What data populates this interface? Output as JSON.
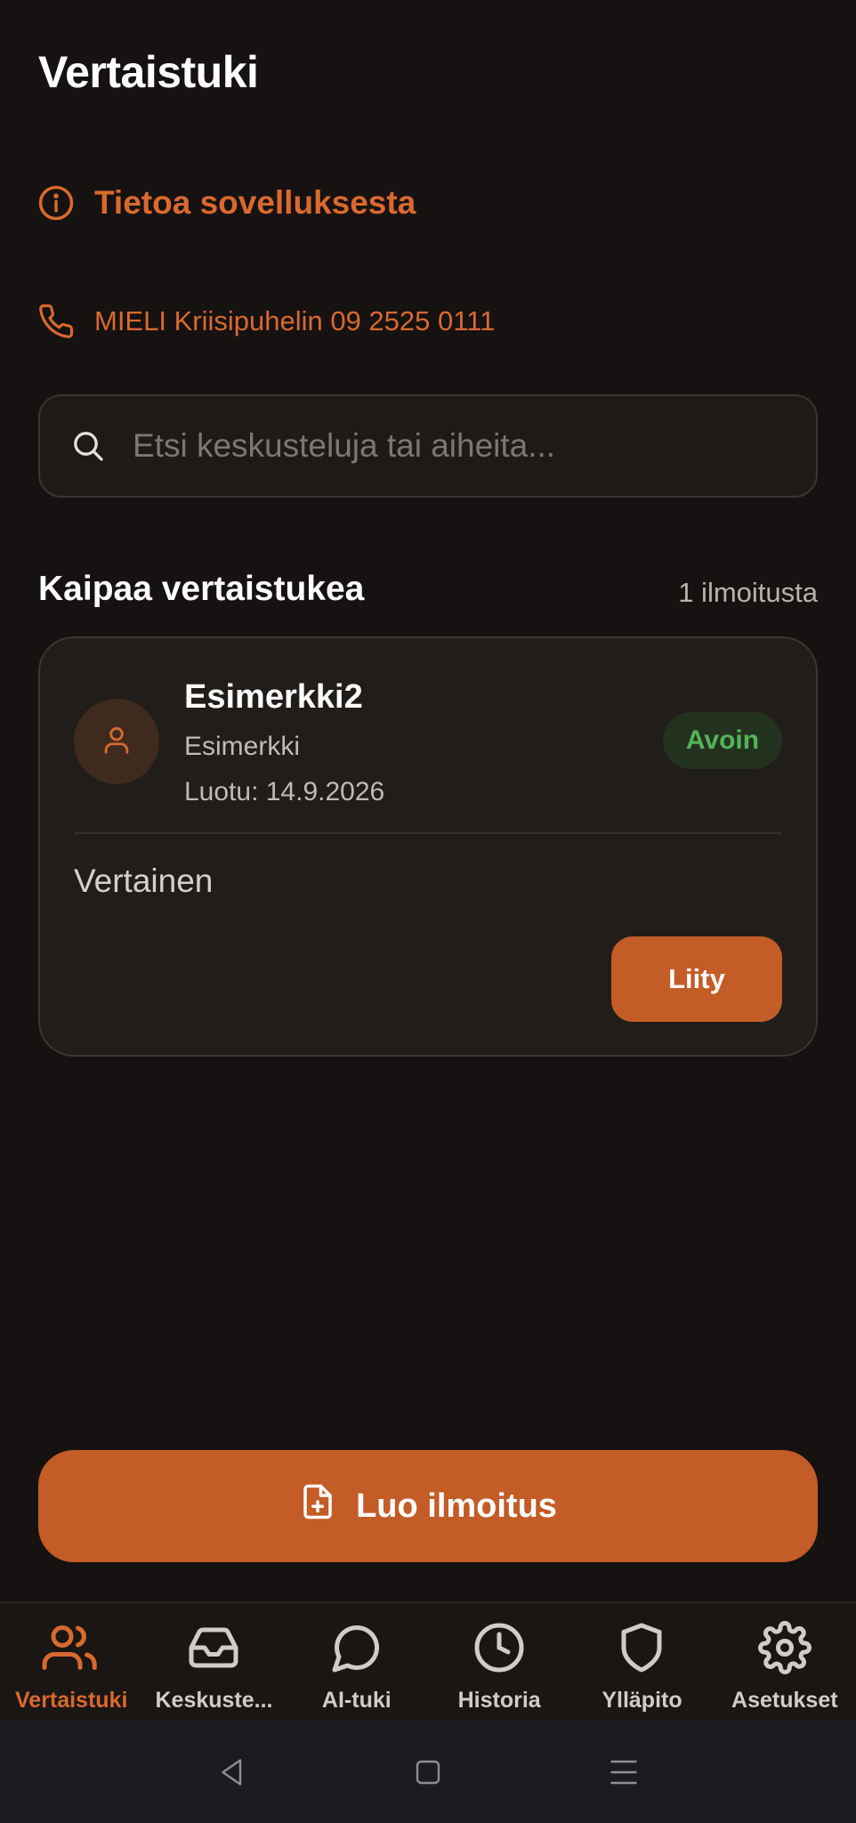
{
  "header": {
    "title": "Vertaistuki"
  },
  "info": {
    "label": "Tietoa sovelluksesta",
    "icon": "info-icon"
  },
  "crisis": {
    "label": "MIELI Kriisipuhelin 09 2525 0111",
    "icon": "phone-icon"
  },
  "search": {
    "placeholder": "Etsi keskusteluja tai aiheita...",
    "value": ""
  },
  "section": {
    "title": "Kaipaa vertaistukea",
    "count": "1 ilmoitusta"
  },
  "card": {
    "name": "Esimerkki2",
    "subtitle": "Esimerkki",
    "created": "Luotu: 14.9.2026",
    "status": "Avoin",
    "body": "Vertainen",
    "join_label": "Liity"
  },
  "create": {
    "label": "Luo ilmoitus"
  },
  "nav": {
    "items": [
      {
        "label": "Vertaistuki",
        "icon": "users-icon",
        "active": true
      },
      {
        "label": "Keskuste...",
        "icon": "inbox-icon",
        "active": false
      },
      {
        "label": "AI-tuki",
        "icon": "chat-bubble-icon",
        "active": false
      },
      {
        "label": "Historia",
        "icon": "clock-icon",
        "active": false
      },
      {
        "label": "Ylläpito",
        "icon": "shield-icon",
        "active": false
      },
      {
        "label": "Asetukset",
        "icon": "gear-icon",
        "active": false
      }
    ]
  },
  "colors": {
    "accent": "#c35c26",
    "accent_text": "#d9692f",
    "background": "#161211",
    "status_open": "#54b35a"
  }
}
